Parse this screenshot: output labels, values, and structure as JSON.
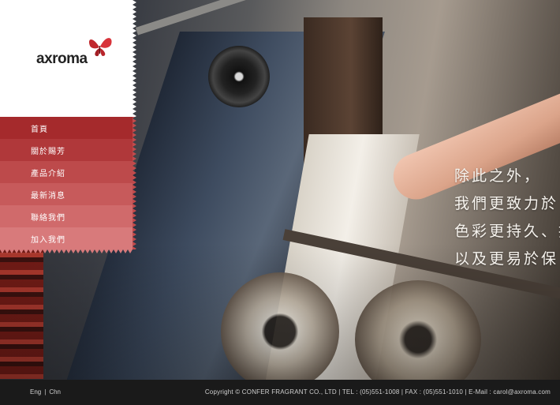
{
  "brand": {
    "name": "axroma",
    "logo_icon": "butterfly-icon",
    "accent": "#b02a2a"
  },
  "slogan": {
    "lines": [
      "除此之外，",
      "我們更致力於",
      "色彩更持久、抗",
      "以及更易於保"
    ]
  },
  "nav": {
    "items": [
      {
        "label": "首頁",
        "color": "#a52a2c"
      },
      {
        "label": "關於賜芳",
        "color": "#b0383a"
      },
      {
        "label": "產品介紹",
        "color": "#bd4a4b"
      },
      {
        "label": "最新消息",
        "color": "#c75a5b"
      },
      {
        "label": "聯絡我們",
        "color": "#d06a6b"
      },
      {
        "label": "加入我們",
        "color": "#d87a7b"
      }
    ]
  },
  "footer": {
    "lang_en": "Eng",
    "lang_sep": "|",
    "lang_zh": "Chn",
    "copyright": "Copyright © CONFER FRAGRANT CO., LTD | TEL : (05)551-1008 | FAX : (05)551-1010 | E-Mail : carol@axroma.com"
  }
}
